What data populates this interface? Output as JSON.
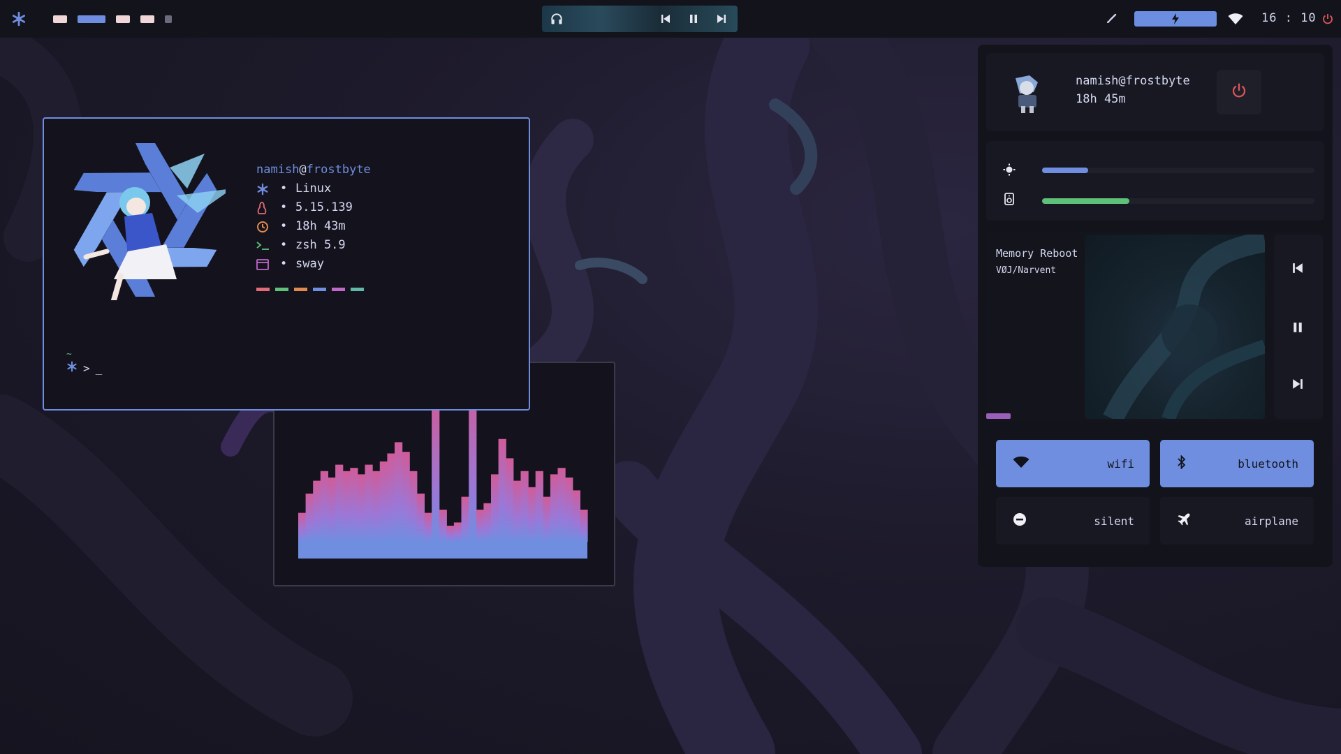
{
  "topbar": {
    "workspaces": [
      {
        "state": "inactive",
        "color": "#f0d6d6"
      },
      {
        "state": "active",
        "color": "#6f8ee0"
      },
      {
        "state": "inactive",
        "color": "#f0d6d6"
      },
      {
        "state": "inactive",
        "color": "#f0d6d6"
      },
      {
        "state": "empty",
        "color": "#6b6b80"
      }
    ],
    "clock": "16 : 10",
    "icons": [
      "nixos-icon",
      "headphones-icon",
      "previous-icon",
      "pause-icon",
      "next-icon",
      "brush-icon",
      "bolt-icon",
      "wifi-icon",
      "power-icon"
    ]
  },
  "terminal": {
    "user": "namish",
    "at": "@",
    "host": "frostbyte",
    "rows": [
      {
        "icon": "nixos-icon",
        "color": "#6f8ee0",
        "value": "Linux"
      },
      {
        "icon": "kernel-icon",
        "color": "#e06c75",
        "value": "5.15.139"
      },
      {
        "icon": "uptime-icon",
        "color": "#e08a50",
        "value": "18h 43m"
      },
      {
        "icon": "shell-icon",
        "color": "#5fc07a",
        "value": "zsh 5.9"
      },
      {
        "icon": "wm-icon",
        "color": "#c068c8",
        "value": "sway"
      }
    ],
    "bullet": "•",
    "swatches": [
      "#e06c75",
      "#5fc07a",
      "#e08a50",
      "#6f8ee0",
      "#c068c8",
      "#5fb8a8"
    ],
    "prompt_dir": "~",
    "prompt_symbol": ">",
    "cursor": "_"
  },
  "visualizer": {
    "levels": [
      0.18,
      0.3,
      0.38,
      0.44,
      0.4,
      0.48,
      0.44,
      0.46,
      0.42,
      0.48,
      0.44,
      0.5,
      0.55,
      0.62,
      0.56,
      0.44,
      0.3,
      0.18,
      0.88,
      0.2,
      0.1,
      0.12,
      0.28,
      0.97,
      0.2,
      0.24,
      0.42,
      0.64,
      0.52,
      0.38,
      0.44,
      0.34,
      0.44,
      0.28,
      0.42,
      0.46,
      0.4,
      0.32,
      0.2
    ],
    "colors": {
      "base": "#6f8ee0",
      "mid": "#9a78d8",
      "top": "#d05c9a"
    }
  },
  "panel": {
    "user": {
      "name": "namish@frostbyte",
      "uptime": "18h 45m"
    },
    "sliders": [
      {
        "icon": "brightness-icon",
        "value": 0.17,
        "color": "#6f8ee0"
      },
      {
        "icon": "volume-icon",
        "value": 0.32,
        "color": "#5fc07a"
      }
    ],
    "music": {
      "title": "Memory Reboot",
      "artist": "VØJ/Narvent",
      "progress": 0.12
    },
    "toggles": [
      {
        "id": "wifi",
        "label": "wifi",
        "icon": "wifi-icon",
        "on": true
      },
      {
        "id": "bluetooth",
        "label": "bluetooth",
        "icon": "bluetooth-icon",
        "on": true
      },
      {
        "id": "silent",
        "label": "silent",
        "icon": "silent-icon",
        "on": false
      },
      {
        "id": "airplane",
        "label": "airplane",
        "icon": "airplane-icon",
        "on": false
      }
    ]
  }
}
